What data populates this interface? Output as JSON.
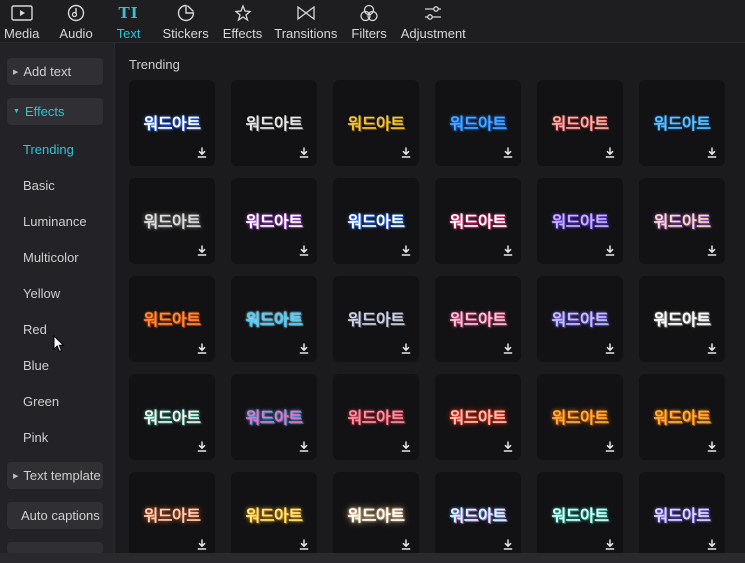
{
  "toolbar": {
    "tabs": [
      {
        "label": "Media",
        "icon": "media-icon"
      },
      {
        "label": "Audio",
        "icon": "audio-icon"
      },
      {
        "label": "Text",
        "icon": "text-icon",
        "glyph": "TI",
        "active": true
      },
      {
        "label": "Stickers",
        "icon": "stickers-icon"
      },
      {
        "label": "Effects",
        "icon": "effects-icon"
      },
      {
        "label": "Transitions",
        "icon": "transitions-icon"
      },
      {
        "label": "Filters",
        "icon": "filters-icon"
      },
      {
        "label": "Adjustment",
        "icon": "adjustment-icon"
      }
    ]
  },
  "sidebar": {
    "add_text": "Add text",
    "effects": "Effects",
    "items": [
      "Trending",
      "Basic",
      "Luminance",
      "Multicolor",
      "Yellow",
      "Red",
      "Blue",
      "Green",
      "Pink"
    ],
    "text_template": "Text template",
    "auto_captions": "Auto captions"
  },
  "main": {
    "section_title": "Trending",
    "word": "워드아트",
    "tiles": [
      {
        "fill": "#ffffff",
        "shadow": "0 0 3px #3a7bff, 1px 1px 0 #1a4fd0"
      },
      {
        "fill": "#e8e8e8",
        "shadow": "1px 1px 0 #555, 0 0 2px #000"
      },
      {
        "fill": "#f3c63b",
        "shadow": "1px 1px 0 #7a5200"
      },
      {
        "fill": "#4aa6ff",
        "shadow": "0 0 3px #1f6fe0, 1px 1px 0 #0a3c8a"
      },
      {
        "fill": "#f3b3b3",
        "shadow": "0 0 2px #c0392b, 1px 1px 0 #7a1e1e"
      },
      {
        "fill": "#5fc0ff",
        "shadow": "0 0 2px #1e7fd0"
      },
      {
        "fill": "#dddddd",
        "shadow": "0 0 4px #888, 1px 1px 0 #444"
      },
      {
        "fill": "#ffffff",
        "shadow": "0 0 3px #b14ddc, 1px 1px 0 #7a2ea8"
      },
      {
        "fill": "#ffffff",
        "shadow": "0 0 3px #2e7fff, 1px 1px 0 #1a4fd0"
      },
      {
        "fill": "#ffffff",
        "shadow": "0 0 3px #ff3a8a, 1px 1px 0 #a31c57"
      },
      {
        "fill": "#c9b3ff",
        "shadow": "0 0 3px #6a3df0, 1px 1px 0 #3c1e9a"
      },
      {
        "fill": "#f6e2a8",
        "shadow": "0 0 3px #b05cf0, 1px 1px 0 #6a2aa0"
      },
      {
        "fill": "#ff8a3a",
        "shadow": "1px 1px 0 #a33a00, 0 0 2px #ff5a00"
      },
      {
        "fill": "#4ad3ff",
        "shadow": "0 0 2px #fff, 1px 1px 0 #0b6aa0"
      },
      {
        "fill": "#cfd3e0",
        "shadow": "1px 1px 0 #4a4f6a"
      },
      {
        "fill": "#f7c5d9",
        "shadow": "0 0 3px #d0407a, 1px 1px 0 #8a2452"
      },
      {
        "fill": "#b8c8ff",
        "shadow": "0 0 3px #8f5be0, 1px 1px 0 #4a2ea0"
      },
      {
        "fill": "#ffffff",
        "shadow": "0 0 2px #bbb, 1px 1px 0 #666"
      },
      {
        "fill": "#fff1e0",
        "shadow": "0 0 3px #2fa9a0, 1px 1px 0 #1a6a64"
      },
      {
        "fill": "#ff6ab4",
        "shadow": "0 0 3px #3ab8ff, 1px 1px 0 #1c6cb0"
      },
      {
        "fill": "#ff8fa0",
        "shadow": "0 0 3px #c83a4a, 1px 1px 0 #7a1a26"
      },
      {
        "fill": "#ffc0c0",
        "shadow": "0 0 6px #ff2a1a, 0 0 2px #ff5a00"
      },
      {
        "fill": "#ffb03a",
        "shadow": "0 0 5px #ff7a00, 1px 1px 0 #8a3a00"
      },
      {
        "fill": "#ffb03a",
        "shadow": "1px 1px 0 #c05a00, 0 0 3px #ff8a00"
      },
      {
        "fill": "#ffd2b8",
        "shadow": "0 0 5px #ff6a2a"
      },
      {
        "fill": "#ffe78a",
        "shadow": "0 0 4px #ffb000, 1px 1px 0 #7a5200"
      },
      {
        "fill": "#ffffff",
        "shadow": "0 0 7px #ffcf8a, 0 0 2px #ffe0b0"
      },
      {
        "fill": "#dff6ff",
        "shadow": "0 0 3px #3a9aff, 1px 1px 0 #ff4a8a"
      },
      {
        "fill": "#d8fff4",
        "shadow": "0 0 3px #2ac0b0, 1px 1px 0 #1a7a70"
      },
      {
        "fill": "#e0d8ff",
        "shadow": "0 0 3px #7a6af0, 1px 1px 0 #3a2a90"
      }
    ]
  }
}
